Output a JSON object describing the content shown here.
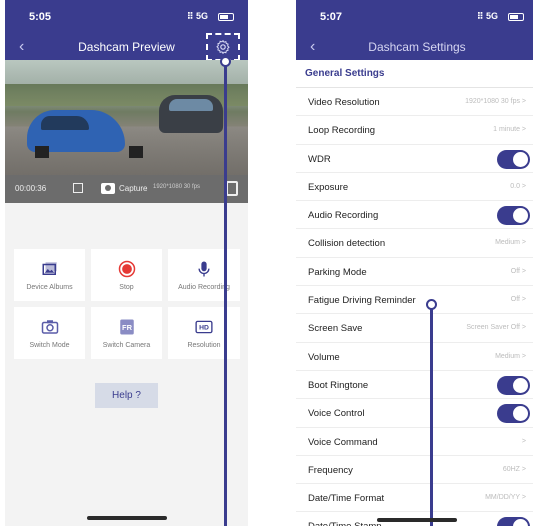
{
  "left_screen": {
    "status": {
      "time": "5:05",
      "signal": "5G"
    },
    "nav": {
      "title": "Dashcam Preview",
      "back": "‹"
    },
    "recording": {
      "elapsed": "00:00:36",
      "capture_label": "Capture",
      "resolution": "1920*1080 30 fps"
    },
    "tiles": [
      {
        "label": "Device Albums",
        "icon": "album-icon"
      },
      {
        "label": "Stop",
        "icon": "stop-record-icon"
      },
      {
        "label": "Audio Recording",
        "icon": "microphone-icon"
      },
      {
        "label": "Switch Mode",
        "icon": "camera-icon"
      },
      {
        "label": "Switch Camera",
        "icon": "switch-camera-icon"
      },
      {
        "label": "Resolution",
        "icon": "hd-icon"
      }
    ],
    "help_label": "Help ?"
  },
  "right_screen": {
    "status": {
      "time": "5:07",
      "signal": "5G"
    },
    "nav": {
      "title": "Dashcam Settings",
      "back": "‹"
    },
    "section_title": "General Settings",
    "rows": [
      {
        "label": "Video Resolution",
        "value": "1920*1080 30 fps >"
      },
      {
        "label": "Loop Recording",
        "value": "1 minute >"
      },
      {
        "label": "WDR",
        "toggle": true
      },
      {
        "label": "Exposure",
        "value": "0.0 >"
      },
      {
        "label": "Audio Recording",
        "toggle": true
      },
      {
        "label": "Collision detection",
        "value": "Medium >"
      },
      {
        "label": "Parking Mode",
        "value": "Off >"
      },
      {
        "label": "Fatigue Driving Reminder",
        "value": "Off >"
      },
      {
        "label": "Screen Save",
        "value": "Screen Saver Off >"
      },
      {
        "label": "Volume",
        "value": "Medium >"
      },
      {
        "label": "Boot Ringtone",
        "toggle": true
      },
      {
        "label": "Voice Control",
        "toggle": true
      },
      {
        "label": "Voice Command",
        "value": ">"
      },
      {
        "label": "Frequency",
        "value": "60HZ >"
      },
      {
        "label": "Date/Time Format",
        "value": "MM/DD/YY >"
      },
      {
        "label": "Date/Time Stamp",
        "toggle": true
      }
    ]
  },
  "colors": {
    "accent": "#3a3c8e",
    "record": "#e53935"
  }
}
